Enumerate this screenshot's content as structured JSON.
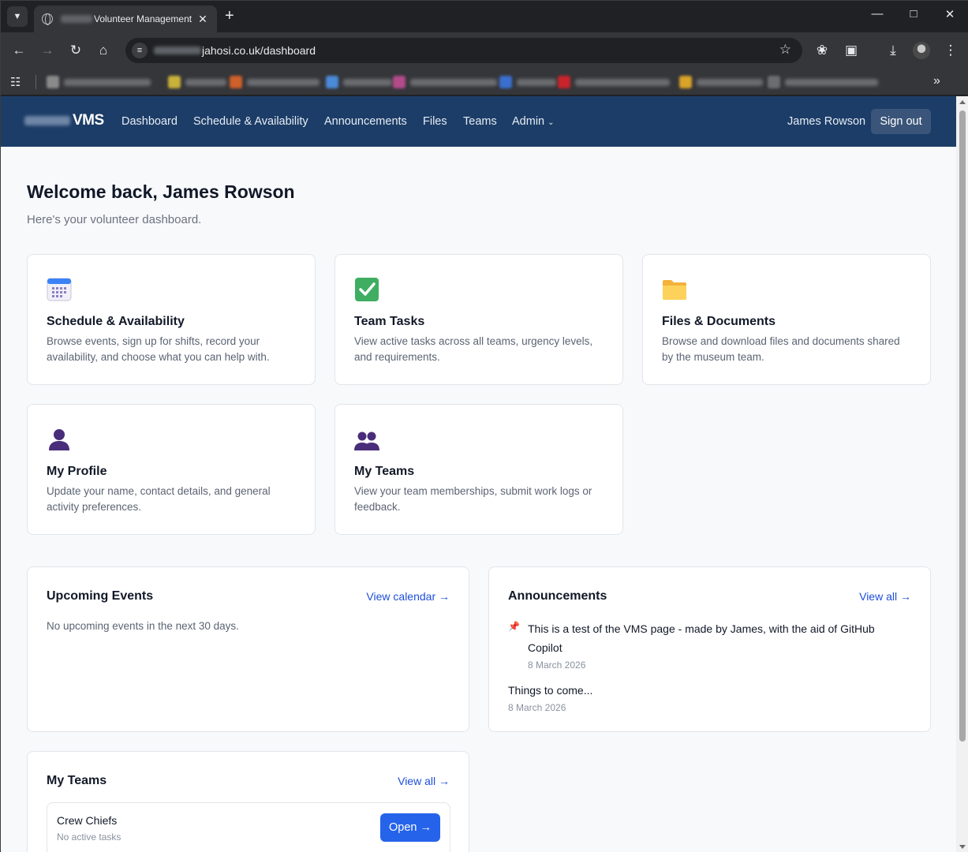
{
  "browser": {
    "tab_title": "Volunteer Management",
    "url": "jahosi.co.uk/dashboard"
  },
  "nav": {
    "brand": "VMS",
    "links": [
      "Dashboard",
      "Schedule & Availability",
      "Announcements",
      "Files",
      "Teams",
      "Admin"
    ],
    "user_name": "James Rowson",
    "signout_label": "Sign out"
  },
  "header": {
    "title": "Welcome back, James Rowson",
    "subtitle": "Here's your volunteer dashboard."
  },
  "cards": [
    {
      "title": "Schedule & Availability",
      "description": "Browse events, sign up for shifts, record your availability, and choose what you can help with.",
      "icon": "calendar-icon"
    },
    {
      "title": "Team Tasks",
      "description": "View active tasks across all teams, urgency levels, and requirements.",
      "icon": "checkmark-icon"
    },
    {
      "title": "Files & Documents",
      "description": "Browse and download files and documents shared by the museum team.",
      "icon": "folder-icon"
    },
    {
      "title": "My Profile",
      "description": "Update your name, contact details, and general activity preferences.",
      "icon": "person-icon"
    },
    {
      "title": "My Teams",
      "description": "View your team memberships, submit work logs or feedback.",
      "icon": "people-icon"
    }
  ],
  "upcoming_events": {
    "title": "Upcoming Events",
    "link": "View calendar →",
    "empty_text": "No upcoming events in the next 30 days."
  },
  "announcements": {
    "title": "Announcements",
    "link": "View all →",
    "items": [
      {
        "title": "This is a test of the VMS page - made by James, with the aid of GitHub Copilot",
        "date": "8 March 2026",
        "pinned": true
      },
      {
        "title": "Things to come...",
        "date": "8 March 2026",
        "pinned": false
      }
    ]
  },
  "my_teams": {
    "title": "My Teams",
    "link": "View all →",
    "items": [
      {
        "name": "Crew Chiefs",
        "status": "No active tasks",
        "button": "Open →"
      }
    ]
  },
  "colors": {
    "nav_bg": "#1c3d67",
    "accent": "#2563eb",
    "link": "#1d4ed8"
  }
}
